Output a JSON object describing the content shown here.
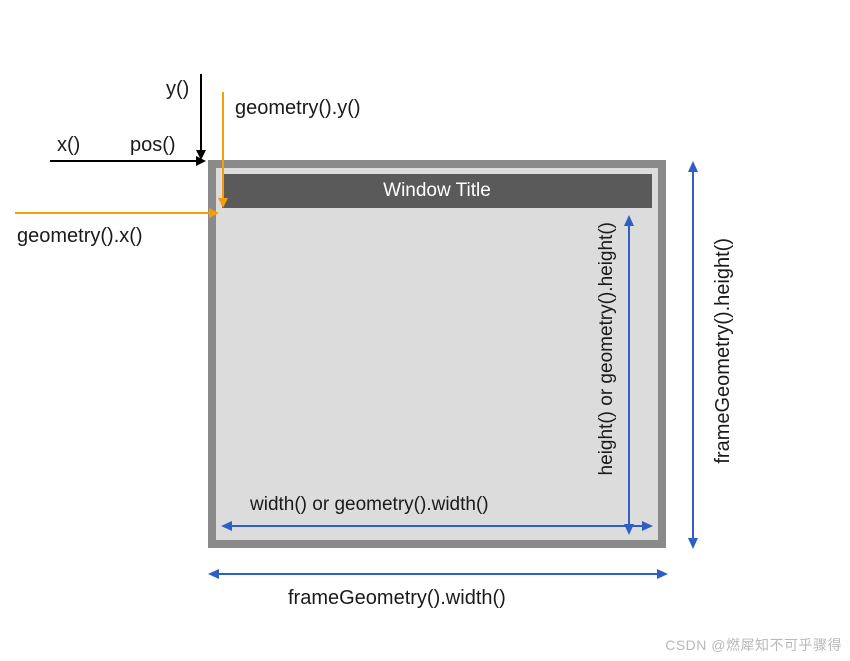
{
  "labels": {
    "y": "y()",
    "x": "x()",
    "pos": "pos()",
    "geom_y": "geometry().y()",
    "geom_x": "geometry().x()",
    "window_title": "Window Title",
    "width": "width() or geometry().width()",
    "height": "height() or geometry().height()",
    "frame_width": "frameGeometry().width()",
    "frame_height": "frameGeometry().height()"
  },
  "watermark": "CSDN @燃犀知不可乎骤得",
  "colors": {
    "frame_border": "#8a8a8a",
    "titlebar": "#5a5a5a",
    "client_bg": "#dcdcdc",
    "blue": "#2f5fc4",
    "orange": "#f59e0b",
    "black": "#000000"
  }
}
